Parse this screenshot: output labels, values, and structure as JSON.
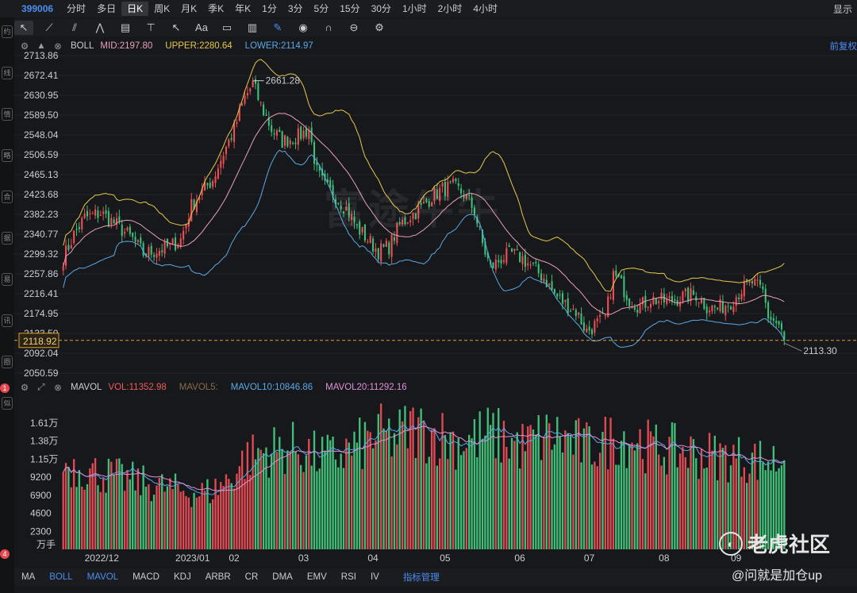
{
  "topbar": {
    "code": "399006",
    "periods": [
      "分时",
      "多日",
      "日K",
      "周K",
      "月K",
      "季K",
      "年K",
      "1分",
      "3分",
      "5分",
      "15分",
      "30分",
      "1小时",
      "2小时",
      "4小时"
    ],
    "active_period": "日K",
    "display_label": "显示"
  },
  "left_rail": {
    "labels": [
      "约",
      "线",
      "情",
      "略",
      "合",
      "据",
      "易",
      "讯",
      "圈",
      "似"
    ],
    "badges": [
      "1",
      "4"
    ]
  },
  "toolbar": {
    "icons": [
      "cursor-icon",
      "line-tool-icon",
      "channel-tool-icon",
      "wave-tool-icon",
      "fib-tool-icon",
      "level-tool-icon",
      "arrow-tool-icon",
      "text-tool-icon",
      "note-tool-icon",
      "measure-tool-icon",
      "pen-icon",
      "eye-icon",
      "magnet-icon",
      "lock-icon",
      "settings-icon"
    ],
    "text_tool_label": "Aa"
  },
  "boll_row": {
    "name": "BOLL",
    "mid": "MID:2197.80",
    "upper": "UPPER:2280.64",
    "lower": "LOWER:2114.97",
    "adjust": "前复权",
    "colors": {
      "mid": "#e8a0b8",
      "upper": "#e6c84a",
      "lower": "#5aa9e6"
    }
  },
  "price_axis": {
    "ticks": [
      "2713.86",
      "2672.41",
      "2630.95",
      "2589.50",
      "2548.04",
      "2506.59",
      "2465.13",
      "2423.68",
      "2382.23",
      "2340.77",
      "2299.32",
      "2257.86",
      "2216.41",
      "2174.95",
      "2133.50",
      "2092.04",
      "2050.59"
    ],
    "current": "2118.92",
    "high_label": "2661.28",
    "low_label": "2113.30"
  },
  "mavol_row": {
    "name": "MAVOL",
    "vol": "VOL:11352.98",
    "mavol5": "MAVOL5:",
    "mavol10": "MAVOL10:10846.86",
    "mavol20": "MAVOL20:11292.16",
    "colors": {
      "vol": "#ef5b5b",
      "mavol10": "#5aa9e6",
      "mavol20": "#e090d8"
    }
  },
  "volume_axis": {
    "ticks": [
      "1.61万",
      "1.38万",
      "1.15万",
      "9200",
      "6900",
      "4600",
      "2300"
    ],
    "unit": "万手"
  },
  "chart_data": {
    "type": "candlestick",
    "title": "399006",
    "x_month_labels": [
      "2022/12",
      "2023/01",
      "02",
      "03",
      "04",
      "05",
      "06",
      "07",
      "08",
      "09"
    ],
    "price_range": [
      2050.59,
      2713.86
    ],
    "annotations": {
      "high": 2661.28,
      "low": 2113.3,
      "current": 2118.92
    },
    "boll_last": {
      "mid": 2197.8,
      "upper": 2280.64,
      "lower": 2114.97
    },
    "volume_last": {
      "vol": 11352.98,
      "mavol10": 10846.86,
      "mavol20": 11292.16
    },
    "volume_range": [
      0,
      18000
    ],
    "close_anchors": [
      [
        0,
        2290
      ],
      [
        4,
        2340
      ],
      [
        8,
        2375
      ],
      [
        14,
        2385
      ],
      [
        20,
        2360
      ],
      [
        26,
        2330
      ],
      [
        30,
        2300
      ],
      [
        34,
        2305
      ],
      [
        40,
        2315
      ],
      [
        44,
        2330
      ],
      [
        48,
        2400
      ],
      [
        52,
        2430
      ],
      [
        56,
        2455
      ],
      [
        60,
        2510
      ],
      [
        64,
        2560
      ],
      [
        68,
        2625
      ],
      [
        71,
        2655
      ],
      [
        74,
        2610
      ],
      [
        78,
        2560
      ],
      [
        82,
        2535
      ],
      [
        88,
        2545
      ],
      [
        92,
        2560
      ],
      [
        95,
        2470
      ],
      [
        98,
        2440
      ],
      [
        102,
        2420
      ],
      [
        106,
        2395
      ],
      [
        110,
        2355
      ],
      [
        114,
        2330
      ],
      [
        118,
        2305
      ],
      [
        122,
        2315
      ],
      [
        126,
        2360
      ],
      [
        130,
        2380
      ],
      [
        134,
        2395
      ],
      [
        138,
        2420
      ],
      [
        142,
        2435
      ],
      [
        146,
        2440
      ],
      [
        150,
        2425
      ],
      [
        154,
        2390
      ],
      [
        157,
        2320
      ],
      [
        160,
        2270
      ],
      [
        164,
        2290
      ],
      [
        168,
        2300
      ],
      [
        172,
        2290
      ],
      [
        176,
        2270
      ],
      [
        180,
        2250
      ],
      [
        184,
        2215
      ],
      [
        188,
        2195
      ],
      [
        192,
        2180
      ],
      [
        196,
        2138
      ],
      [
        199,
        2150
      ],
      [
        203,
        2165
      ],
      [
        206,
        2255
      ],
      [
        208,
        2245
      ],
      [
        212,
        2205
      ],
      [
        216,
        2190
      ],
      [
        220,
        2205
      ],
      [
        226,
        2200
      ],
      [
        232,
        2210
      ],
      [
        237,
        2215
      ],
      [
        241,
        2190
      ],
      [
        245,
        2185
      ],
      [
        250,
        2200
      ],
      [
        254,
        2225
      ],
      [
        258,
        2240
      ],
      [
        262,
        2220
      ],
      [
        264,
        2170
      ],
      [
        268,
        2150
      ],
      [
        270,
        2118.92
      ]
    ],
    "volume_anchors": [
      [
        0,
        11000
      ],
      [
        10,
        10000
      ],
      [
        20,
        9300
      ],
      [
        30,
        8500
      ],
      [
        40,
        7800
      ],
      [
        50,
        7200
      ],
      [
        56,
        7500
      ],
      [
        62,
        9000
      ],
      [
        68,
        11500
      ],
      [
        74,
        12500
      ],
      [
        80,
        12800
      ],
      [
        88,
        13000
      ],
      [
        94,
        12000
      ],
      [
        100,
        11800
      ],
      [
        106,
        12500
      ],
      [
        112,
        13500
      ],
      [
        118,
        14800
      ],
      [
        124,
        14200
      ],
      [
        130,
        15500
      ],
      [
        136,
        15000
      ],
      [
        142,
        14500
      ],
      [
        148,
        13800
      ],
      [
        154,
        14200
      ],
      [
        160,
        14800
      ],
      [
        166,
        14000
      ],
      [
        172,
        13200
      ],
      [
        178,
        14200
      ],
      [
        184,
        14600
      ],
      [
        190,
        13800
      ],
      [
        196,
        13000
      ],
      [
        202,
        13600
      ],
      [
        208,
        14500
      ],
      [
        214,
        14200
      ],
      [
        220,
        13000
      ],
      [
        226,
        12800
      ],
      [
        232,
        12600
      ],
      [
        238,
        12200
      ],
      [
        244,
        12000
      ],
      [
        250,
        11800
      ],
      [
        256,
        11600
      ],
      [
        262,
        11400
      ],
      [
        270,
        11352.98
      ]
    ]
  },
  "bottom_tabs": [
    "MA",
    "BOLL",
    "MAVOL",
    "MACD",
    "KDJ",
    "ARBR",
    "CR",
    "DMA",
    "EMV",
    "RSI",
    "IV",
    "指标管理"
  ],
  "active_tabs": [
    "BOLL",
    "MAVOL"
  ],
  "watermark": "富途牛牛",
  "footer": {
    "brand": "老虎社区",
    "author": "@问就是加仓up"
  }
}
